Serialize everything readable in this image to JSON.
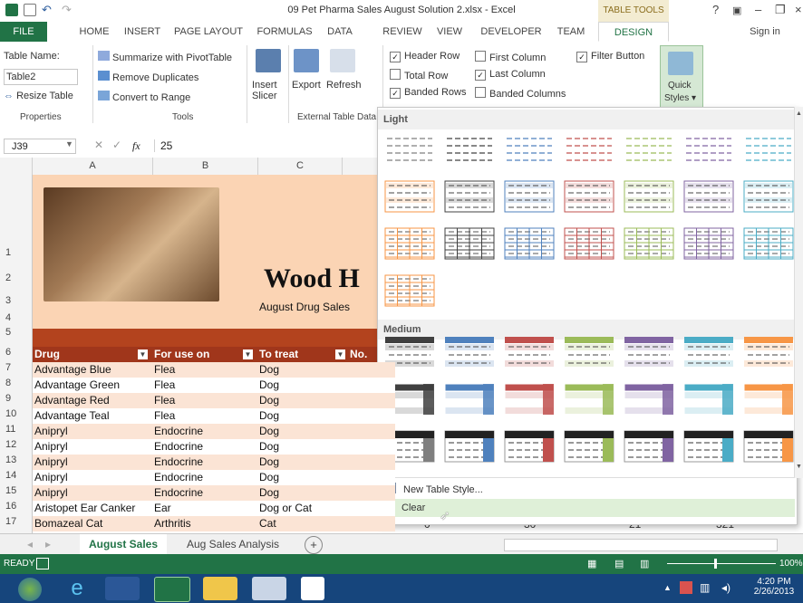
{
  "window": {
    "title": "09 Pet Pharma Sales August Solution 2.xlsx - Excel",
    "context_header": "TABLE TOOLS",
    "help": "?",
    "sign_in": "Sign in"
  },
  "tabs": [
    "FILE",
    "HOME",
    "INSERT",
    "PAGE LAYOUT",
    "FORMULAS",
    "DATA",
    "REVIEW",
    "VIEW",
    "DEVELOPER",
    "TEAM",
    "DESIGN"
  ],
  "ribbon": {
    "properties": {
      "table_name_label": "Table Name:",
      "table_name_value": "Table2",
      "resize": "Resize Table",
      "group": "Properties"
    },
    "tools": {
      "summarize": "Summarize with PivotTable",
      "remove_dup": "Remove Duplicates",
      "convert": "Convert to Range",
      "group": "Tools"
    },
    "insert_slicer": [
      "Insert",
      "Slicer"
    ],
    "external": {
      "export": "Export",
      "refresh": "Refresh",
      "group": "External Table Data"
    },
    "options": {
      "header_row": "Header Row",
      "total_row": "Total Row",
      "banded_rows": "Banded Rows",
      "first_column": "First Column",
      "last_column": "Last Column",
      "banded_columns": "Banded Columns",
      "filter_button": "Filter Button",
      "checked": {
        "header_row": true,
        "total_row": false,
        "banded_rows": true,
        "first_column": false,
        "last_column": true,
        "banded_columns": false,
        "filter_button": true
      }
    },
    "quick_styles": [
      "Quick",
      "Styles"
    ]
  },
  "formula_bar": {
    "cell_ref": "J39",
    "fx": "fx",
    "value": "25"
  },
  "columns": [
    "A",
    "B",
    "C"
  ],
  "rows": [
    "1",
    "2",
    "3",
    "4",
    "5",
    "6",
    "7",
    "8",
    "9",
    "10",
    "11",
    "12",
    "13",
    "14",
    "15",
    "16",
    "17"
  ],
  "banner": {
    "title": "Wood H",
    "subtitle": "August Drug Sales"
  },
  "table": {
    "headers": [
      "Drug",
      "For use on",
      "To treat",
      "No."
    ],
    "rows": [
      [
        "Advantage Blue",
        "Flea",
        "Dog"
      ],
      [
        "Advantage Green",
        "Flea",
        "Dog"
      ],
      [
        "Advantage Red",
        "Flea",
        "Dog"
      ],
      [
        "Advantage Teal",
        "Flea",
        "Dog"
      ],
      [
        "Anipryl",
        "Endocrine",
        "Dog"
      ],
      [
        "Anipryl",
        "Endocrine",
        "Dog"
      ],
      [
        "Anipryl",
        "Endocrine",
        "Dog"
      ],
      [
        "Anipryl",
        "Endocrine",
        "Dog"
      ],
      [
        "Anipryl",
        "Endocrine",
        "Dog"
      ],
      [
        "Aristopet Ear Canker",
        "Ear",
        "Dog or Cat"
      ],
      [
        "Bomazeal Cat",
        "Arthritis",
        "Cat"
      ]
    ]
  },
  "gallery": {
    "light_label": "Light",
    "medium_label": "Medium",
    "new_style": "New Table Style...",
    "clear": "Clear",
    "palette": [
      "#7f7f7f",
      "#404040",
      "#4f81bd",
      "#c0504d",
      "#9bbb59",
      "#8064a2",
      "#4bacc6",
      "#f79646"
    ],
    "light_pale": [
      "#ffffff",
      "#d9d9d9",
      "#dbe5f1",
      "#f2dcdb",
      "#ebf1dd",
      "#e5e0ec",
      "#dbeef3",
      "#fde9d9"
    ]
  },
  "sheet_tabs": {
    "active": "August Sales",
    "other": "Aug Sales Analysis",
    "add": "+"
  },
  "status": {
    "ready": "READY",
    "zoom": "100%"
  },
  "clock": {
    "time": "4:20 PM",
    "date": "2/26/2013"
  },
  "partial_row17": [
    "0",
    "30",
    "21",
    "321"
  ]
}
